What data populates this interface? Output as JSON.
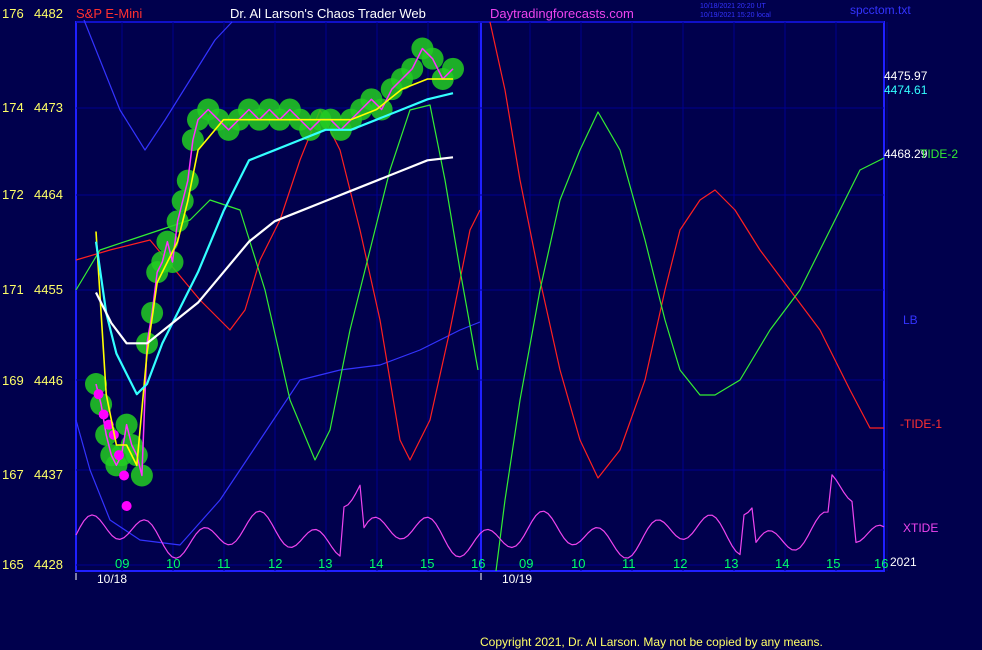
{
  "header": {
    "symbol": "S&P E-Mini",
    "title": "Dr. Al Larson's Chaos Trader Web",
    "site": "Daytradingforecasts.com",
    "stamp_line1": "10/18/2021 20:20 UT",
    "stamp_line2": "10/19/2021 15:20 local",
    "file": "spcctom.txt"
  },
  "copyright": "Copyright 2021, Dr. Al Larson. May not be copied by any means.",
  "colors": {
    "background": "#00004d",
    "plot_border": "#2020ff",
    "grid": "#000090",
    "price_axis_text": "#ffff66",
    "hour_text": "#00ff66",
    "date_text": "#ffffff",
    "bubble": "#22cc22",
    "price_bars": "#ff33ff",
    "ema_yellow": "#ffff00",
    "ema_cyan": "#33ffff",
    "ema_white": "#ffffff",
    "tide1": "#ff2020",
    "tide2": "#33ee33",
    "lb": "#3333ff",
    "xtide": "#ee44ee",
    "magenta_dots": "#ff00ff"
  },
  "chart_data": {
    "type": "line",
    "title": "S&P E-Mini",
    "y_left_labels": [
      {
        "idx": "176",
        "price": "4482"
      },
      {
        "idx": "174",
        "price": "4473"
      },
      {
        "idx": "172",
        "price": "4464"
      },
      {
        "idx": "171",
        "price": "4455"
      },
      {
        "idx": "169",
        "price": "4446"
      },
      {
        "idx": "167",
        "price": "4437"
      },
      {
        "idx": "165",
        "price": "4428"
      }
    ],
    "ylim": [
      4428,
      4482
    ],
    "x_hour_labels": [
      "09",
      "10",
      "11",
      "12",
      "13",
      "14",
      "15",
      "16",
      "09",
      "10",
      "11",
      "12",
      "13",
      "14",
      "15",
      "16"
    ],
    "x_date_labels": [
      "10/18",
      "10/19"
    ],
    "year_label": "2021",
    "right_value_labels": {
      "yellow": "4475.97",
      "cyan": "4474.61",
      "white": "4468.29"
    },
    "series_labels": {
      "tide2": "TIDE-2",
      "lb": "LB",
      "tide1": "-TIDE-1",
      "xtide": "XTIDE"
    },
    "series": [
      {
        "name": "price",
        "x": [
          0,
          0.1,
          0.2,
          0.3,
          0.4,
          0.5,
          0.6,
          0.7,
          0.8,
          0.9,
          1.0,
          1.1,
          1.2,
          1.3,
          1.4,
          1.5,
          1.6,
          1.7,
          1.8,
          1.9,
          2.0,
          2.2,
          2.4,
          2.6,
          2.8,
          3.0,
          3.2,
          3.4,
          3.6,
          3.8,
          4.0,
          4.2,
          4.4,
          4.6,
          4.8,
          5.0,
          5.2,
          5.4,
          5.6,
          5.8,
          6.0,
          6.2,
          6.4,
          6.6,
          6.8,
          7.0
        ],
        "y": [
          4446,
          4444,
          4441,
          4439,
          4438,
          4439,
          4442,
          4440,
          4439,
          4437,
          4450,
          4453,
          4457,
          4458,
          4460,
          4458,
          4462,
          4464,
          4466,
          4470,
          4472,
          4473,
          4472,
          4471,
          4472,
          4473,
          4472,
          4473,
          4472,
          4473,
          4472,
          4471,
          4472,
          4472,
          4471,
          4472,
          4473,
          4474,
          4473,
          4475,
          4476,
          4477,
          4479,
          4478,
          4476,
          4477
        ]
      },
      {
        "name": "ema_yellow",
        "x": [
          0,
          0.2,
          0.4,
          0.6,
          0.8,
          1.0,
          1.2,
          1.4,
          1.6,
          1.8,
          2.0,
          2.5,
          3.0,
          3.5,
          4.0,
          4.5,
          5.0,
          5.5,
          6.0,
          6.5,
          7.0
        ],
        "y": [
          4461,
          4445,
          4440,
          4440,
          4438,
          4449,
          4456,
          4458,
          4460,
          4464,
          4469,
          4472,
          4472,
          4472,
          4472,
          4472,
          4472,
          4473,
          4475,
          4476,
          4476
        ]
      },
      {
        "name": "ema_cyan",
        "x": [
          0,
          0.2,
          0.4,
          0.6,
          0.8,
          1.0,
          1.3,
          1.6,
          2.0,
          2.5,
          3.0,
          3.5,
          4.0,
          4.5,
          5.0,
          5.5,
          6.0,
          6.5,
          7.0
        ],
        "y": [
          4460,
          4453,
          4449,
          4447,
          4445,
          4446,
          4450,
          4453,
          4457,
          4463,
          4468,
          4469,
          4470,
          4471,
          4471,
          4472,
          4473,
          4474,
          4474.6
        ]
      },
      {
        "name": "ema_white",
        "x": [
          0,
          0.3,
          0.6,
          1.0,
          1.5,
          2.0,
          2.5,
          3.0,
          3.5,
          4.0,
          4.5,
          5.0,
          5.5,
          6.0,
          6.5,
          7.0
        ],
        "y": [
          4455,
          4452,
          4450,
          4450,
          4452,
          4454,
          4457,
          4460,
          4462,
          4463,
          4464,
          4465,
          4466,
          4467,
          4468,
          4468.3
        ]
      }
    ],
    "dates": [
      "10/18",
      "10/19"
    ],
    "hours_per_day": [
      9,
      10,
      11,
      12,
      13,
      14,
      15,
      16
    ]
  }
}
